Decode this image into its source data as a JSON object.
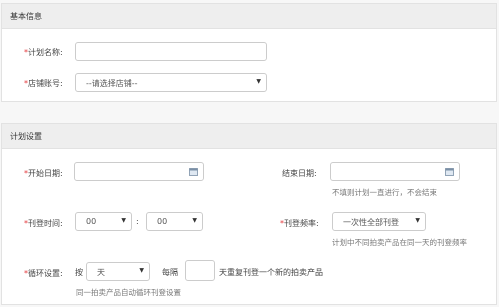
{
  "basic": {
    "title": "基本信息",
    "plan_name_label": "计划名称:",
    "shop_label": "店铺账号:",
    "shop_select": "--请选择店铺--"
  },
  "plan": {
    "title": "计划设置",
    "start_label": "开始日期:",
    "end_label": "结束日期:",
    "end_hint": "不填则计划一直进行，不会结束",
    "time_label": "刊登时间:",
    "hour_value": "00",
    "minute_value": "00",
    "colon": ":",
    "freq_label": "刊登频率:",
    "freq_value": "一次性全部刊登",
    "freq_hint": "计划中不同拍卖产品在同一天的刊登频率",
    "cycle_label": "循环设置:",
    "cycle_prefix": "按",
    "cycle_unit": "天",
    "every_label": "每隔",
    "every_value": "",
    "every_suffix": "天重复刊登一个新的拍卖产品",
    "cycle_hint": "同一拍卖产品自动循环刊登设置"
  },
  "required_mark": "*",
  "colors": {
    "required": "#e4393c",
    "header_bg": "#eeeeee",
    "border": "#cccccc"
  },
  "icons": {
    "dropdown": "triangle-down",
    "calendar": "calendar-icon"
  }
}
